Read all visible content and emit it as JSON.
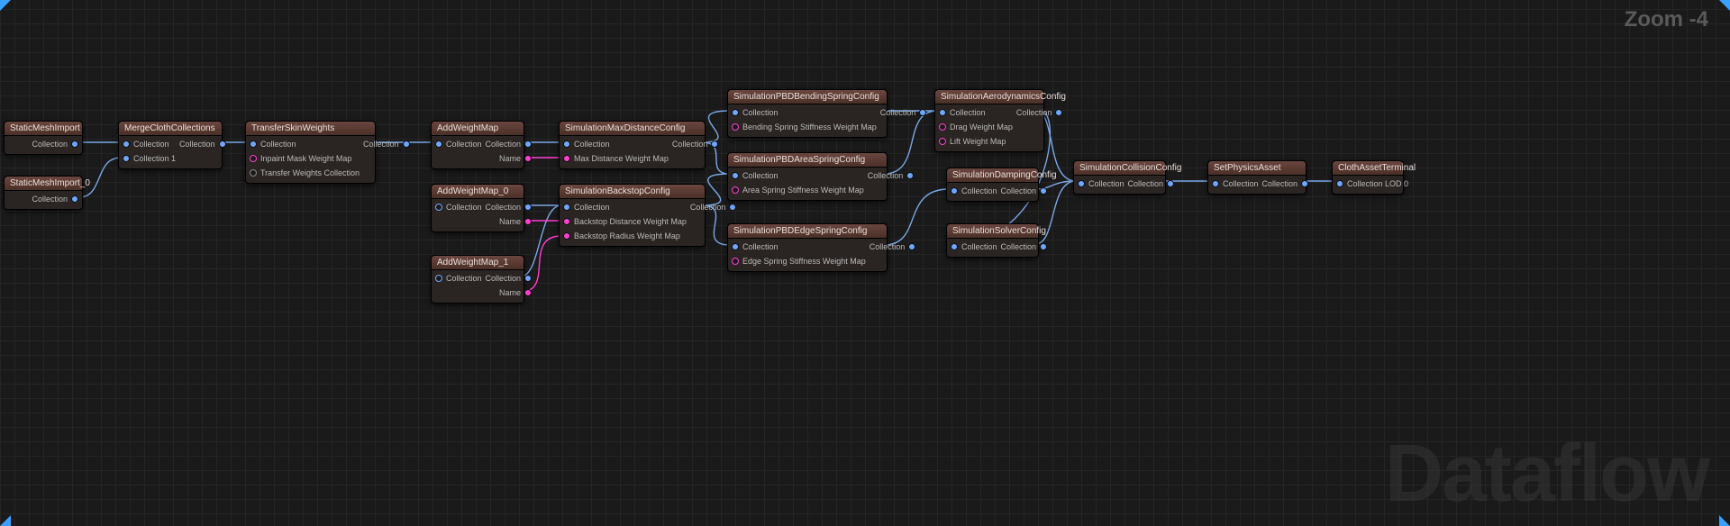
{
  "viewport": {
    "zoom_label": "Zoom -4",
    "watermark": "Dataflow"
  },
  "nodes": {
    "staticMeshImport": {
      "title": "StaticMeshImport",
      "out": {
        "collection": "Collection"
      }
    },
    "staticMeshImport0": {
      "title": "StaticMeshImport_0",
      "out": {
        "collection": "Collection"
      }
    },
    "mergeClothCollections": {
      "title": "MergeClothCollections",
      "in": {
        "collection": "Collection",
        "collection1": "Collection 1"
      },
      "out": {
        "collection": "Collection"
      }
    },
    "transferSkinWeights": {
      "title": "TransferSkinWeights",
      "in": {
        "collection": "Collection",
        "inpaintMask": "Inpaint Mask Weight Map",
        "transferWeights": "Transfer Weights Collection"
      },
      "out": {
        "collection": "Collection"
      }
    },
    "addWeightMap": {
      "title": "AddWeightMap",
      "in": {
        "collection": "Collection"
      },
      "out": {
        "collection": "Collection",
        "name": "Name"
      }
    },
    "addWeightMap0": {
      "title": "AddWeightMap_0",
      "in": {
        "collection": "Collection"
      },
      "out": {
        "collection": "Collection",
        "name": "Name"
      }
    },
    "addWeightMap1": {
      "title": "AddWeightMap_1",
      "in": {
        "collection": "Collection"
      },
      "out": {
        "collection": "Collection",
        "name": "Name"
      }
    },
    "simMaxDistance": {
      "title": "SimulationMaxDistanceConfig",
      "in": {
        "collection": "Collection",
        "maxDist": "Max Distance Weight Map"
      },
      "out": {
        "collection": "Collection"
      }
    },
    "simBackstop": {
      "title": "SimulationBackstopConfig",
      "in": {
        "collection": "Collection",
        "backDist": "Backstop Distance Weight Map",
        "backRad": "Backstop Radius Weight Map"
      },
      "out": {
        "collection": "Collection"
      }
    },
    "simPbdBending": {
      "title": "SimulationPBDBendingSpringConfig",
      "in": {
        "collection": "Collection",
        "bend": "Bending Spring Stiffness Weight Map"
      },
      "out": {
        "collection": "Collection"
      }
    },
    "simPbdArea": {
      "title": "SimulationPBDAreaSpringConfig",
      "in": {
        "collection": "Collection",
        "area": "Area Spring Stiffness Weight Map"
      },
      "out": {
        "collection": "Collection"
      }
    },
    "simPbdEdge": {
      "title": "SimulationPBDEdgeSpringConfig",
      "in": {
        "collection": "Collection",
        "edge": "Edge Spring Stiffness Weight Map"
      },
      "out": {
        "collection": "Collection"
      }
    },
    "simAero": {
      "title": "SimulationAerodynamicsConfig",
      "in": {
        "collection": "Collection",
        "drag": "Drag Weight Map",
        "lift": "Lift Weight Map"
      },
      "out": {
        "collection": "Collection"
      }
    },
    "simDamping": {
      "title": "SimulationDampingConfig",
      "in": {
        "collection": "Collection"
      },
      "out": {
        "collection": "Collection"
      }
    },
    "simSolver": {
      "title": "SimulationSolverConfig",
      "in": {
        "collection": "Collection"
      },
      "out": {
        "collection": "Collection"
      }
    },
    "simCollision": {
      "title": "SimulationCollisionConfig",
      "in": {
        "collection": "Collection"
      },
      "out": {
        "collection": "Collection"
      }
    },
    "setPhysicsAsset": {
      "title": "SetPhysicsAsset",
      "in": {
        "collection": "Collection"
      },
      "out": {
        "collection": "Collection"
      }
    },
    "clothAssetTerminal": {
      "title": "ClothAssetTerminal",
      "in": {
        "collectionLod0": "Collection LOD 0"
      }
    }
  }
}
